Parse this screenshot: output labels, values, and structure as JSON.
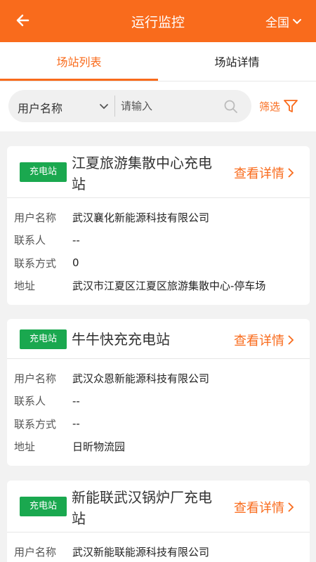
{
  "header": {
    "title": "运行监控",
    "region": "全国"
  },
  "tabs": [
    {
      "label": "场站列表",
      "active": true
    },
    {
      "label": "场站详情",
      "active": false
    }
  ],
  "search": {
    "type_label": "用户名称",
    "placeholder": "请输入",
    "filter_label": "筛选"
  },
  "field_labels": {
    "user": "用户名称",
    "contact": "联系人",
    "phone": "联系方式",
    "address": "地址"
  },
  "stations": [
    {
      "badge": "充电站",
      "name": "江夏旅游集散中心充电站",
      "detail_label": "查看详情",
      "user": "武汉襄化新能源科技有限公司",
      "contact": "--",
      "phone": "0",
      "address": "武汉市江夏区江夏区旅游集散中心-停车场"
    },
    {
      "badge": "充电站",
      "name": "牛牛快充充电站",
      "detail_label": "查看详情",
      "user": "武汉众恩新能源科技有限公司",
      "contact": "--",
      "phone": "--",
      "address": "日昕物流园"
    },
    {
      "badge": "充电站",
      "name": "新能联武汉锅炉厂充电站",
      "detail_label": "查看详情",
      "user": "武汉新能联能源科技有限公司"
    }
  ],
  "colors": {
    "accent": "#f96b1c",
    "badge_green": "#1aa84f",
    "background": "#f2f2f2"
  },
  "icons": [
    "back-arrow-icon",
    "chevron-down-icon",
    "search-icon",
    "filter-icon",
    "chevron-right-icon"
  ]
}
